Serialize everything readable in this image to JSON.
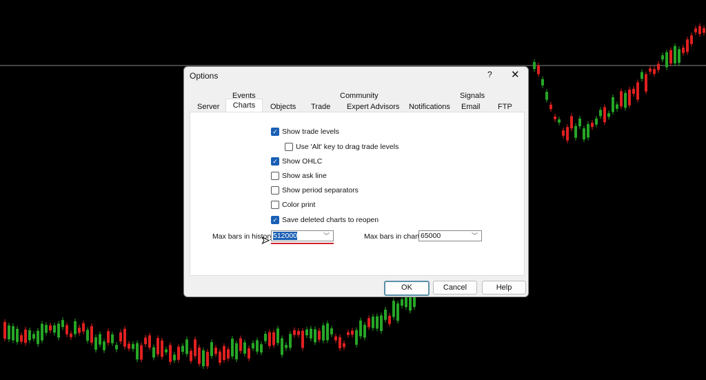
{
  "dialog": {
    "title": "Options",
    "help": "?",
    "close": "✕",
    "tabs_row1": [
      "Events",
      "Community",
      "Signals"
    ],
    "tabs_row2": [
      "Server",
      "Charts",
      "Objects",
      "Trade",
      "Expert Advisors",
      "Notifications",
      "Email",
      "FTP"
    ],
    "selected_tab": "Charts",
    "checkboxes": [
      {
        "label": "Show trade levels",
        "checked": true
      },
      {
        "label": "Use 'Alt' key to drag trade levels",
        "checked": false
      },
      {
        "label": "Show OHLC",
        "checked": true
      },
      {
        "label": "Show ask line",
        "checked": false
      },
      {
        "label": "Show period separators",
        "checked": false
      },
      {
        "label": "Color print",
        "checked": false
      },
      {
        "label": "Save deleted charts to reopen",
        "checked": true
      }
    ],
    "max_bars_history_label": "Max bars in history:",
    "max_bars_history": "512000",
    "max_bars_chart_label": "Max bars in chart:",
    "max_bars_chart": "65000",
    "ok": "OK",
    "cancel": "Cancel",
    "help_btn": "Help"
  },
  "colors": {
    "bull": "#26a626",
    "bear": "#e02020",
    "highlight": "#1a5fb4",
    "underline": "#d0202a"
  }
}
